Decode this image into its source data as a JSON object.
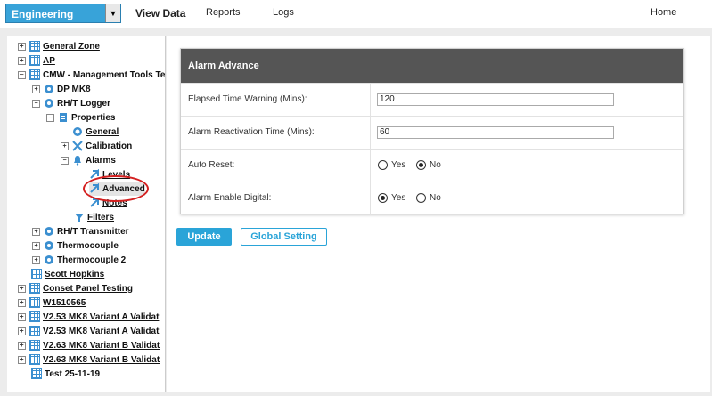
{
  "header": {
    "department": "Engineering",
    "nav": [
      "View Data",
      "Reports",
      "Logs"
    ],
    "home": "Home"
  },
  "tree": [
    {
      "label": "General Zone",
      "icon": "grid-icon",
      "expander": "+"
    },
    {
      "label": "AP",
      "icon": "grid-icon",
      "expander": "+"
    },
    {
      "label": "CMW - Management Tools Te",
      "icon": "grid-icon",
      "expander": "−"
    },
    {
      "label": "DP MK8",
      "icon": "sensor-icon",
      "expander": "+"
    },
    {
      "label": "RH/T Logger",
      "icon": "sensor-icon",
      "expander": "−"
    },
    {
      "label": "Properties",
      "icon": "document-icon",
      "expander": "−"
    },
    {
      "label": "General",
      "icon": "info-icon",
      "expander": ""
    },
    {
      "label": "Calibration",
      "icon": "tools-icon",
      "expander": "+"
    },
    {
      "label": "Alarms",
      "icon": "bell-icon",
      "expander": "−"
    },
    {
      "label": "Levels",
      "icon": "arrow-icon",
      "expander": ""
    },
    {
      "label": "Advanced",
      "icon": "arrow-icon",
      "expander": ""
    },
    {
      "label": "Notes",
      "icon": "arrow-icon",
      "expander": ""
    },
    {
      "label": "Filters",
      "icon": "filter-icon",
      "expander": ""
    },
    {
      "label": "RH/T Transmitter",
      "icon": "sensor-icon",
      "expander": "+"
    },
    {
      "label": "Thermocouple",
      "icon": "sensor-icon",
      "expander": "+"
    },
    {
      "label": "Thermocouple 2",
      "icon": "sensor-icon",
      "expander": "+"
    },
    {
      "label": "Scott Hopkins",
      "icon": "grid-icon",
      "expander": ""
    },
    {
      "label": "Conset Panel Testing",
      "icon": "grid-icon",
      "expander": "+"
    },
    {
      "label": "W1510565",
      "icon": "grid-icon",
      "expander": "+"
    },
    {
      "label": "V2.53 MK8 Variant A Validat",
      "icon": "grid-icon",
      "expander": "+"
    },
    {
      "label": "V2.53 MK8 Variant A Validat",
      "icon": "grid-icon",
      "expander": "+"
    },
    {
      "label": "V2.63 MK8 Variant B Validat",
      "icon": "grid-icon",
      "expander": "+"
    },
    {
      "label": "V2.63 MK8 Variant B Validat",
      "icon": "grid-icon",
      "expander": "+"
    },
    {
      "label": "Test 25-11-19",
      "icon": "grid-icon",
      "expander": ""
    }
  ],
  "form": {
    "title": "Alarm Advance",
    "elapsed_label": "Elapsed Time Warning (Mins):",
    "elapsed_value": "120",
    "reactivation_label": "Alarm Reactivation Time (Mins):",
    "reactivation_value": "60",
    "auto_reset_label": "Auto Reset:",
    "auto_reset_yes": "Yes",
    "auto_reset_no": "No",
    "auto_reset_selected": "No",
    "digital_label": "Alarm Enable Digital:",
    "digital_yes": "Yes",
    "digital_no": "No",
    "digital_selected": "Yes"
  },
  "buttons": {
    "update": "Update",
    "global": "Global Setting"
  },
  "colors": {
    "accent": "#2aa4d8",
    "card_header": "#555555",
    "highlight": "#d42020"
  }
}
